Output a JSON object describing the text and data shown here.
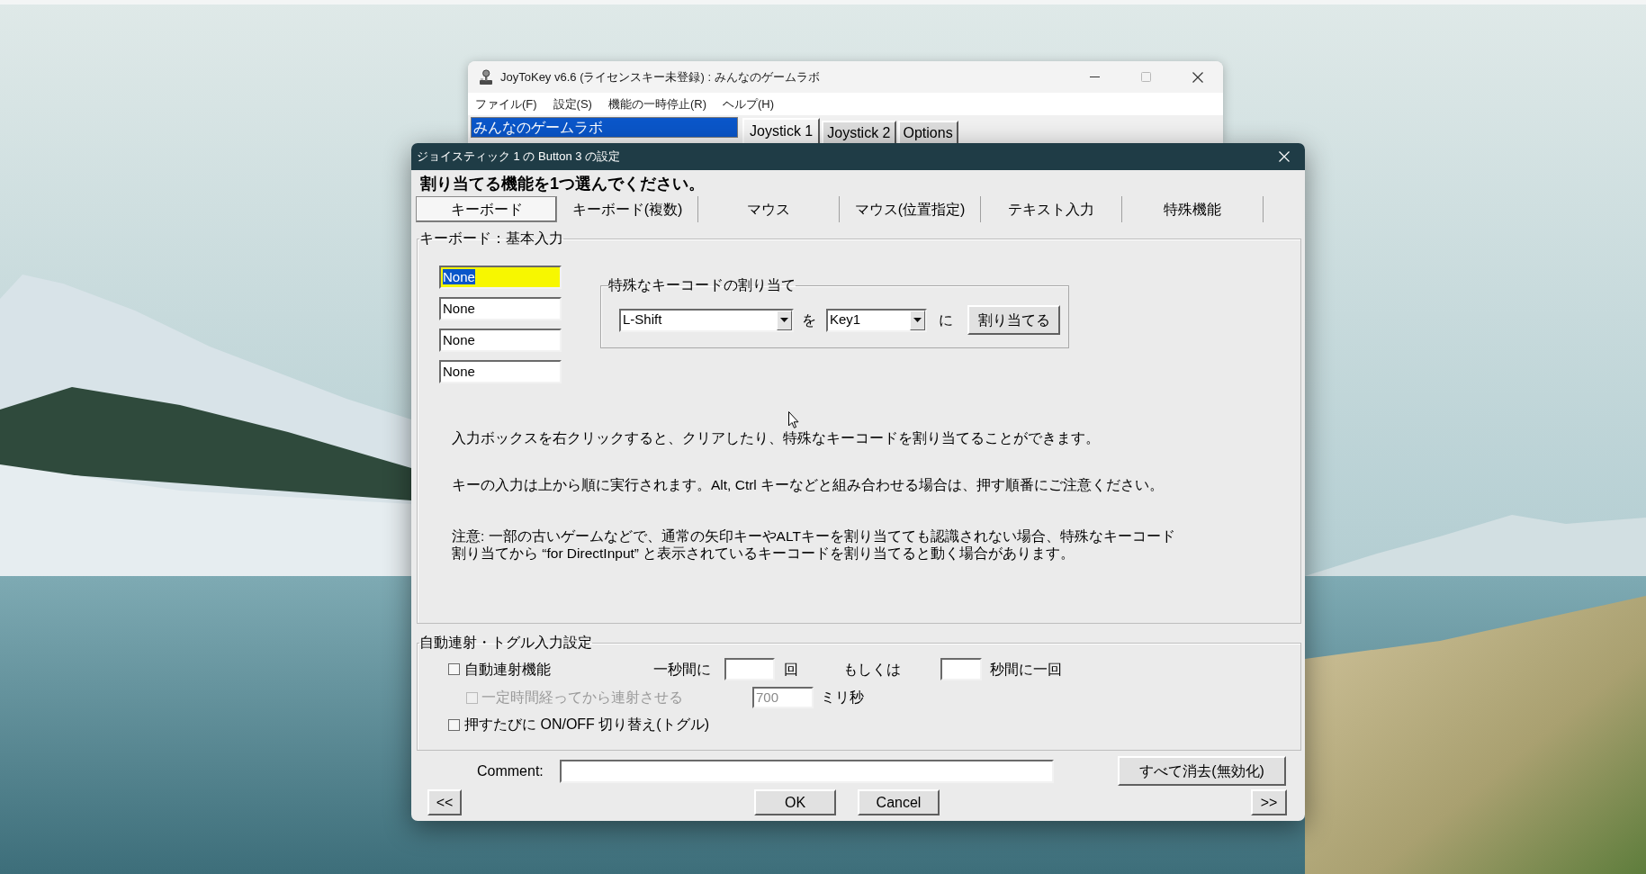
{
  "main_window": {
    "title": "JoyToKey v6.6 (ライセンスキー未登録) : みんなのゲームラボ",
    "menu": [
      "ファイル(F)",
      "設定(S)",
      "機能の一時停止(R)",
      "ヘルプ(H)"
    ],
    "profiles": [
      {
        "label": "みんなのゲームラボ",
        "selected": true
      }
    ],
    "tabs": [
      {
        "label": "Joystick 1",
        "selected": true
      },
      {
        "label": "Joystick 2",
        "selected": false
      },
      {
        "label": "Options",
        "selected": false
      }
    ]
  },
  "dialog": {
    "title": "ジョイスティック 1 の Button 3 の設定",
    "heading": "割り当てる機能を1つ選んでください。",
    "tabs": [
      {
        "label": "キーボード",
        "selected": true
      },
      {
        "label": "キーボード(複数)",
        "selected": false
      },
      {
        "label": "マウス",
        "selected": false
      },
      {
        "label": "マウス(位置指定)",
        "selected": false
      },
      {
        "label": "テキスト入力",
        "selected": false
      },
      {
        "label": "特殊機能",
        "selected": false
      }
    ],
    "keyboard_group": {
      "legend": "キーボード：基本入力",
      "key_fields": [
        {
          "value": "None",
          "selected": true
        },
        {
          "value": "None",
          "selected": false
        },
        {
          "value": "None",
          "selected": false
        },
        {
          "value": "None",
          "selected": false
        }
      ],
      "special_keycode": {
        "legend": "特殊なキーコードの割り当て",
        "key": "L-Shift",
        "particle_1": "を",
        "target": "Key1",
        "particle_2": "に",
        "assign_button": "割り当てる"
      },
      "notes": [
        {
          "lines": [
            "入力ボックスを右クリックすると、クリアしたり、特殊なキーコードを割り当てることができます。"
          ]
        },
        {
          "lines": [
            "キーの入力は上から順に実行されます。Alt, Ctrl キーなどと組み合わせる場合は、押す順番にご注意ください。"
          ]
        },
        {
          "lines": [
            "注意: 一部の古いゲームなどで、通常の矢印キーやALTキーを割り当てても認識されない場合、特殊なキーコード",
            "割り当てから “for DirectInput” と表示されているキーコードを割り当てると動く場合があります。"
          ]
        }
      ]
    },
    "autofire_group": {
      "legend": "自動連射・トグル入力設定",
      "autofire": {
        "label": "自動連射機能",
        "checked": false
      },
      "rate": {
        "label": "一秒間に",
        "unit": "回"
      },
      "interval": {
        "label": "もしくは",
        "unit": "秒間に一回"
      },
      "delay": {
        "label": "一定時間経ってから連射させる",
        "checked": false,
        "disabled": true,
        "value": "700",
        "unit": "ミリ秒"
      },
      "toggle": {
        "label": "押すたびに ON/OFF 切り替え(トグル)",
        "checked": false
      }
    },
    "comment": {
      "label": "Comment:"
    },
    "clear_button": "すべて消去(無効化)",
    "prev_button": "<<",
    "ok_button": "OK",
    "cancel_button": "Cancel",
    "next_button": ">>"
  }
}
